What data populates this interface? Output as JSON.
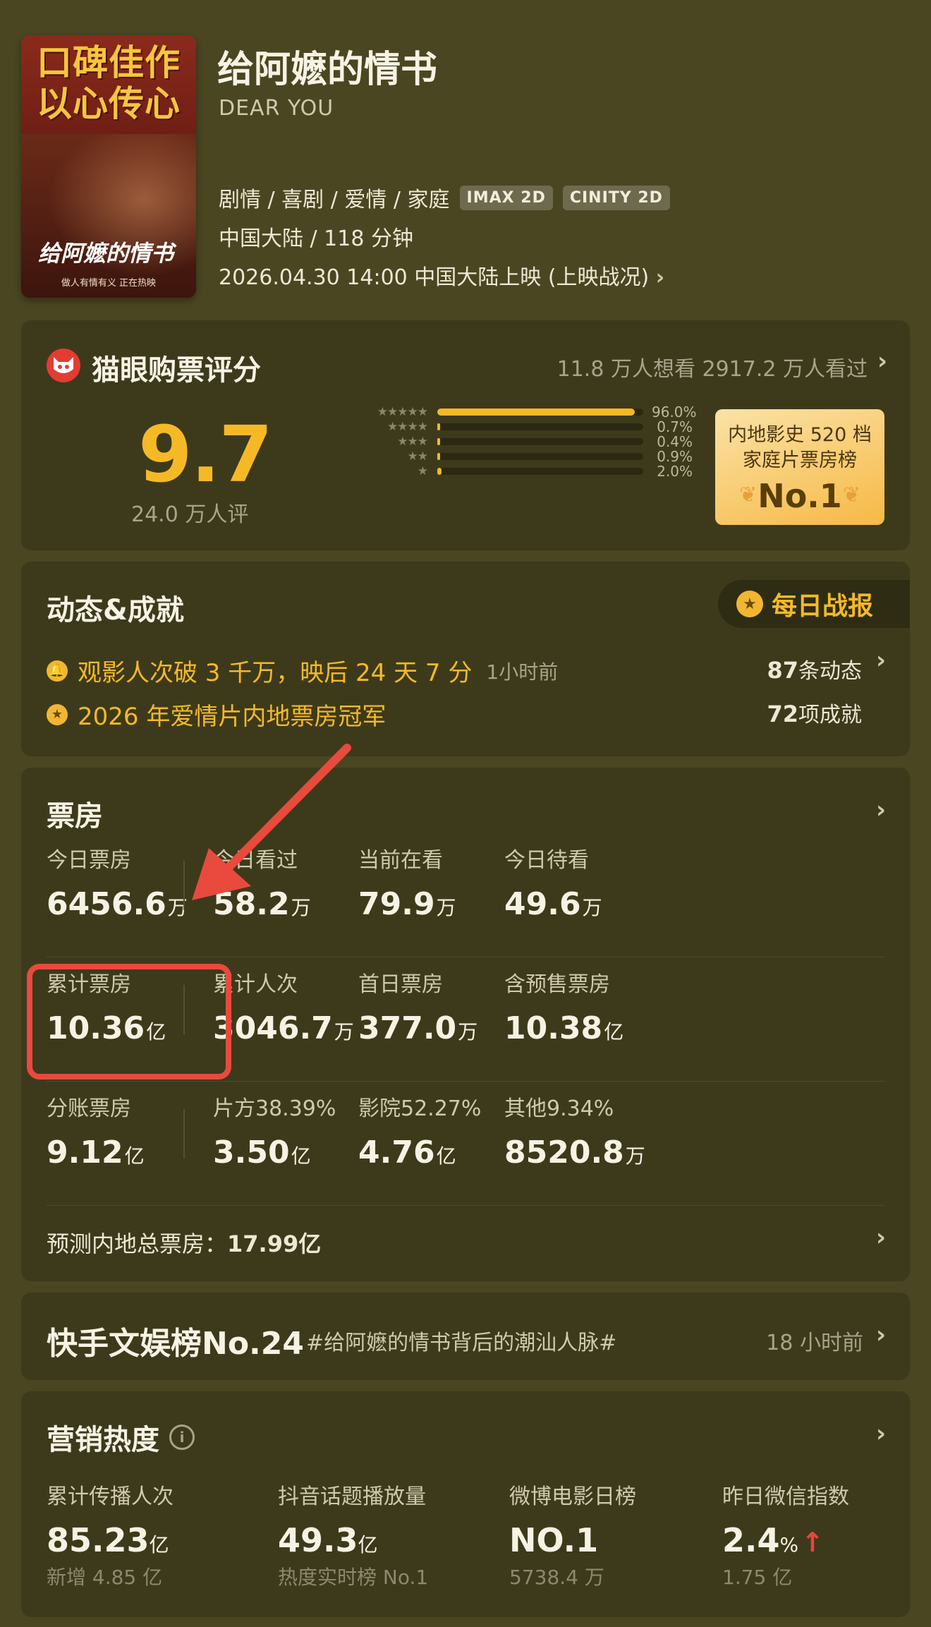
{
  "movie": {
    "poster_slogan_line1": "口碑佳作",
    "poster_slogan_line2": "以心传心",
    "poster_title": "给阿嬷的情书",
    "poster_subtitle": "做人有情有义  正在热映",
    "title": "给阿嬷的情书",
    "english_title": "DEAR YOU",
    "genres": "剧情 / 喜剧 / 爱情 / 家庭",
    "formats": [
      "IMAX 2D",
      "CINITY 2D"
    ],
    "region_duration": "中国大陆 / 118 分钟",
    "release": "2026.04.30 14:00 中国大陆上映 (上映战况)"
  },
  "rating": {
    "title": "猫眼购票评分",
    "stats": "11.8 万人想看  2917.2 万人看过",
    "score": "9.7",
    "count": "24.0 万人评",
    "distribution": [
      {
        "stars": "★★★★★",
        "percent": 96.0,
        "label": "96.0%"
      },
      {
        "stars": "★★★★",
        "percent": 0.7,
        "label": "0.7%"
      },
      {
        "stars": "★★★",
        "percent": 0.4,
        "label": "0.4%"
      },
      {
        "stars": "★★",
        "percent": 0.9,
        "label": "0.9%"
      },
      {
        "stars": "★",
        "percent": 2.0,
        "label": "2.0%"
      }
    ],
    "rank_line1": "内地影史 520 档",
    "rank_line2": "家庭片票房榜",
    "rank_value": "No.1"
  },
  "dynamics": {
    "title": "动态&成就",
    "daily_report": "每日战报",
    "item1": "观影人次破 3 千万，映后 24 天 7 分",
    "item1_time": "1小时前",
    "item2": "2026 年爱情片内地票房冠军",
    "count1_num": "87",
    "count1_unit": "条动态",
    "count2_num": "72",
    "count2_unit": "项成就"
  },
  "boxoffice": {
    "title": "票房",
    "rows": [
      [
        {
          "label": "今日票房",
          "value": "6456.6",
          "unit": "万"
        },
        {
          "label": "今日看过",
          "value": "58.2",
          "unit": "万"
        },
        {
          "label": "当前在看",
          "value": "79.9",
          "unit": "万"
        },
        {
          "label": "今日待看",
          "value": "49.6",
          "unit": "万"
        }
      ],
      [
        {
          "label": "累计票房",
          "value": "10.36",
          "unit": "亿"
        },
        {
          "label": "累计人次",
          "value": "3046.7",
          "unit": "万"
        },
        {
          "label": "首日票房",
          "value": "377.0",
          "unit": "万"
        },
        {
          "label": "含预售票房",
          "value": "10.38",
          "unit": "亿"
        }
      ],
      [
        {
          "label": "分账票房",
          "value": "9.12",
          "unit": "亿"
        },
        {
          "label": "片方38.39%",
          "value": "3.50",
          "unit": "亿"
        },
        {
          "label": "影院52.27%",
          "value": "4.76",
          "unit": "亿"
        },
        {
          "label": "其他9.34%",
          "value": "8520.8",
          "unit": "万"
        }
      ]
    ],
    "forecast_label": "预测内地总票房：",
    "forecast_value": "17.99亿"
  },
  "kuaishou": {
    "title": "快手文娱榜No.24",
    "tag": "#给阿嬷的情书背后的潮汕人脉#",
    "time": "18 小时前"
  },
  "marketing": {
    "title": "营销热度",
    "items": [
      {
        "label": "累计传播人次",
        "value": "85.23",
        "unit": "亿",
        "sub": "新增 4.85 亿"
      },
      {
        "label": "抖音话题播放量",
        "value": "49.3",
        "unit": "亿",
        "sub": "热度实时榜 No.1"
      },
      {
        "label": "微博电影日榜",
        "value": "NO.1",
        "unit": "",
        "sub": "5738.4 万"
      },
      {
        "label": "昨日微信指数",
        "value": "2.4",
        "unit": "%",
        "sub": "1.75 亿"
      }
    ]
  },
  "colors": {
    "background": "#4a4622",
    "card": "#3d3a1c",
    "accent": "#f6b926",
    "highlight": "#e84a3d"
  },
  "icons": [
    "maoyan-cat-icon",
    "medal-icon",
    "bell-icon",
    "chevron-right-icon",
    "info-icon",
    "arrow-up-icon"
  ]
}
